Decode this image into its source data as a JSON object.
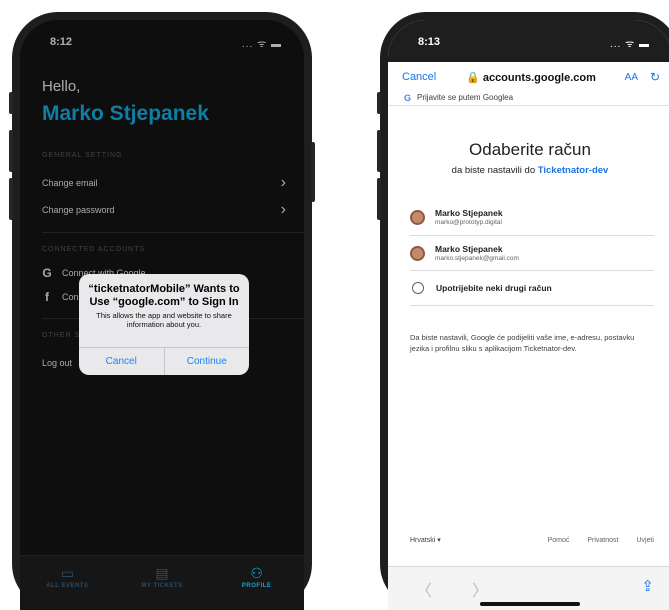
{
  "left_phone": {
    "status": {
      "time": "8:12",
      "icons": "... ᯤ ▬"
    },
    "greeting": "Hello,",
    "user_name": "Marko Stjepanek",
    "general_setting": {
      "title": "GENERAL SETTING",
      "items": [
        {
          "label": "Change email"
        },
        {
          "label": "Change password"
        }
      ]
    },
    "connected_accounts": {
      "title": "CONNECTED ACCOUNTS",
      "items": [
        {
          "icon": "G",
          "label": "Connect with Google"
        },
        {
          "icon": "f",
          "label": "Connect with Facebook"
        }
      ]
    },
    "other_settings": {
      "title": "OTHER SETTINGS",
      "logout": "Log out"
    },
    "alert": {
      "title": "“ticketnatorMobile” Wants to Use “google.com” to Sign In",
      "message": "This allows the app and website to share information about you.",
      "cancel": "Cancel",
      "continue": "Continue"
    },
    "tabs": [
      {
        "label": "ALL EVENTS",
        "icon": "▭"
      },
      {
        "label": "MY TICKETS",
        "icon": "▤"
      },
      {
        "label": "PROFILE",
        "icon": "⚇"
      }
    ],
    "colors": {
      "accent": "#13a8d8",
      "background": "#131313"
    }
  },
  "right_phone": {
    "status": {
      "time": "8:13",
      "icons": "... ᯤ ▬"
    },
    "safari": {
      "cancel": "Cancel",
      "url": "🔒 accounts.google.com",
      "aa": "AA",
      "reload": "↻"
    },
    "google_strip": {
      "logo": "G",
      "text": "Prijavite se putem Googlea"
    },
    "title": "Odaberite račun",
    "subtitle_prefix": "da biste nastavili do",
    "subtitle_app": "Ticketnator-dev",
    "accounts": [
      {
        "name": "Marko Stjepanek",
        "email": "marko@prototyp.digital"
      },
      {
        "name": "Marko Stjepanek",
        "email": "marko.stjepanek@gmail.com"
      }
    ],
    "other_account": "Upotrijebite neki drugi račun",
    "privacy_text": "Da biste nastavili, Google će podijeliti vaše ime, e-adresu, postavku jezika i profilnu sliku s aplikacijom Ticketnator-dev.",
    "footer": {
      "language": "Hrvatski ▾",
      "links": [
        "Pomoć",
        "Privatnost",
        "Uvjeti"
      ]
    },
    "toolbar": {
      "back": "〈",
      "forward": "〉",
      "share": "⇪"
    },
    "colors": {
      "link": "#1a73e8"
    }
  }
}
